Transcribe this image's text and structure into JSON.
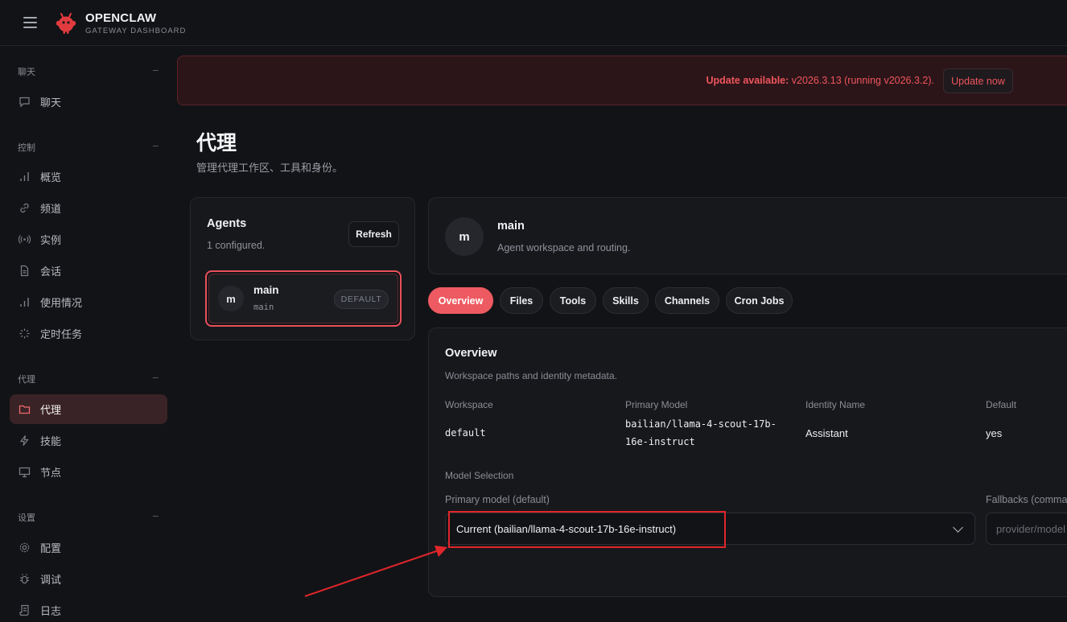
{
  "brand": {
    "name": "OPENCLAW",
    "subtitle": "GATEWAY DASHBOARD"
  },
  "sidebar": {
    "groups": [
      {
        "label": "聊天",
        "items": [
          {
            "label": "聊天",
            "icon": "chat-bubble-icon"
          }
        ]
      },
      {
        "label": "控制",
        "items": [
          {
            "label": "概览",
            "icon": "bar-chart-icon"
          },
          {
            "label": "频道",
            "icon": "link-icon"
          },
          {
            "label": "实例",
            "icon": "broadcast-icon"
          },
          {
            "label": "会话",
            "icon": "document-icon"
          },
          {
            "label": "使用情况",
            "icon": "bar-chart-icon"
          },
          {
            "label": "定时任务",
            "icon": "loader-icon"
          }
        ]
      },
      {
        "label": "代理",
        "items": [
          {
            "label": "代理",
            "icon": "folder-icon",
            "active": true
          },
          {
            "label": "技能",
            "icon": "lightning-icon"
          },
          {
            "label": "节点",
            "icon": "monitor-icon"
          }
        ]
      },
      {
        "label": "设置",
        "items": [
          {
            "label": "配置",
            "icon": "gear-icon"
          },
          {
            "label": "调试",
            "icon": "bug-icon"
          },
          {
            "label": "日志",
            "icon": "scroll-icon"
          }
        ]
      }
    ],
    "collapse_glyph": "−"
  },
  "banner": {
    "prefix": "Update available:",
    "message": " v2026.3.13 (running v2026.3.2).",
    "button": "Update now",
    "color": "#f0555c"
  },
  "page": {
    "title": "代理",
    "subtitle": "管理代理工作区、工具和身份。"
  },
  "agents_panel": {
    "title": "Agents",
    "count": "1 configured.",
    "refresh": "Refresh",
    "agents": [
      {
        "avatar": "m",
        "name": "main",
        "id": "main",
        "badge": "DEFAULT"
      }
    ]
  },
  "agent_header": {
    "avatar": "m",
    "name": "main",
    "description": "Agent workspace and routing."
  },
  "tabs": [
    {
      "label": "Overview",
      "active": true
    },
    {
      "label": "Files"
    },
    {
      "label": "Tools"
    },
    {
      "label": "Skills"
    },
    {
      "label": "Channels"
    },
    {
      "label": "Cron Jobs"
    }
  ],
  "overview": {
    "title": "Overview",
    "subtitle": "Workspace paths and identity metadata.",
    "fields": {
      "workspace": {
        "label": "Workspace",
        "value": "default"
      },
      "primary_model": {
        "label": "Primary Model",
        "value_line1": "bailian/llama-4-scout-17b-",
        "value_line2": "16e-instruct"
      },
      "identity_name": {
        "label": "Identity Name",
        "value": "Assistant"
      },
      "default": {
        "label": "Default",
        "value": "yes"
      }
    },
    "model_selection": {
      "label": "Model Selection",
      "primary_label": "Primary model (default)",
      "primary_selected": "Current (bailian/llama-4-scout-17b-16e-instruct)",
      "fallbacks_label": "Fallbacks (comma-",
      "fallbacks_placeholder": "provider/model"
    }
  },
  "colors": {
    "accent": "#ee5a61",
    "annotation": "#e0262b",
    "background": "#121316"
  }
}
